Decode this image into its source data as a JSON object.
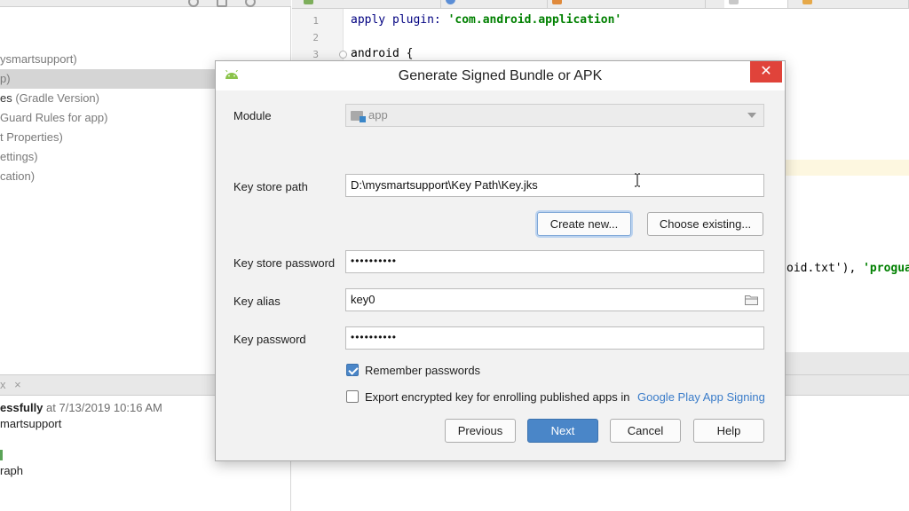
{
  "project_tree": {
    "items": [
      {
        "prefix": "",
        "text": "ysmartsupport)",
        "muted": true
      },
      {
        "prefix": "",
        "text": "p)",
        "muted": true
      },
      {
        "prefix": "es",
        "text": " (Gradle Version)",
        "muted": true
      },
      {
        "prefix": "",
        "text": "Guard Rules for app)",
        "muted": true
      },
      {
        "prefix": "",
        "text": "t Properties)",
        "muted": true
      },
      {
        "prefix": "",
        "text": "ettings)",
        "muted": true
      },
      {
        "prefix": "",
        "text": "cation)",
        "muted": true
      }
    ]
  },
  "build_panel": {
    "close_marks": "x ×",
    "line1_text": "essfully",
    "line1_time": " at 7/13/2019 10:16 AM",
    "line2_text": "martsupport",
    "line3_text": "raph"
  },
  "editor": {
    "line_numbers": [
      "1",
      "2",
      "3"
    ],
    "line1_keyword": "apply plugin: ",
    "line1_string": "'com.android.application'",
    "line3_text": "android {",
    "right_code_plain": "oid.txt'), ",
    "right_code_string": "'proguar"
  },
  "dialog": {
    "title": "Generate Signed Bundle or APK",
    "close_glyph": "✕",
    "module": {
      "label": "Module",
      "value": "app"
    },
    "key_store_path": {
      "label": "Key store path",
      "value": "D:\\mysmartsupport\\Key Path\\Key.jks"
    },
    "create_new_label": "Create new...",
    "choose_existing_label": "Choose existing...",
    "key_store_password": {
      "label": "Key store password",
      "masked_value": "••••••••••"
    },
    "key_alias": {
      "label": "Key alias",
      "value": "key0"
    },
    "key_password": {
      "label": "Key password",
      "masked_value": "••••••••••"
    },
    "remember_passwords": {
      "label": "Remember passwords",
      "checked": true
    },
    "export_encrypted": {
      "label": "Export encrypted key for enrolling published apps in",
      "checked": false
    },
    "google_play_link": "Google Play App Signing",
    "buttons": {
      "previous": "Previous",
      "next": "Next",
      "cancel": "Cancel",
      "help": "Help"
    }
  },
  "colors": {
    "primary_button": "#4a86c8",
    "close_button": "#e0433a",
    "link": "#3a7cc9",
    "string_literal": "#008000"
  }
}
